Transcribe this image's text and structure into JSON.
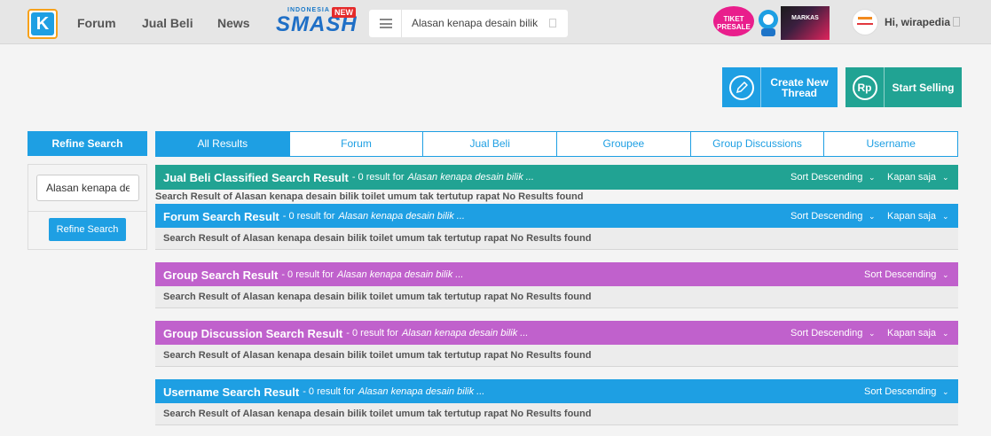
{
  "nav": {
    "logo": "K",
    "links": [
      "Forum",
      "Jual Beli",
      "News"
    ],
    "smash": {
      "top": "INDONESIA",
      "main": "SMASH",
      "badge": "NEW"
    },
    "search_value": "Alasan kenapa desain bilik",
    "promo": {
      "ticket_line1": "TIKET",
      "ticket_line2": "PRESALE",
      "event": "MARKAS"
    },
    "user_greeting": "Hi, wirapedia"
  },
  "actions": {
    "create_line1": "Create New",
    "create_line2": "Thread",
    "sell_icon": "Rp",
    "sell_label": "Start Selling"
  },
  "refine": {
    "heading": "Refine Search",
    "input_value": "Alasan kenapa desain bilik",
    "button": "Refine Search"
  },
  "tabs": [
    "All Results",
    "Forum",
    "Jual Beli",
    "Groupee",
    "Group Discussions",
    "Username"
  ],
  "results": [
    {
      "title": "Jual Beli Classified Search Result",
      "count": "- 0 result for",
      "query": "Alasan kenapa desain bilik ...",
      "sort": "Sort Descending",
      "time": "Kapan saja",
      "body": "Search Result of Alasan kenapa desain bilik toilet umum tak tertutup rapat No Results found"
    },
    {
      "title": "Forum Search Result",
      "count": "- 0 result for",
      "query": "Alasan kenapa desain bilik ...",
      "sort": "Sort Descending",
      "time": "Kapan saja",
      "body": "Search Result of Alasan kenapa desain bilik toilet umum tak tertutup rapat No Results found"
    },
    {
      "title": "Group Search Result",
      "count": "- 0 result for",
      "query": "Alasan kenapa desain bilik ...",
      "sort": "Sort Descending",
      "body": "Search Result of Alasan kenapa desain bilik toilet umum tak tertutup rapat No Results found"
    },
    {
      "title": "Group Discussion Search Result",
      "count": "- 0 result for",
      "query": "Alasan kenapa desain bilik ...",
      "sort": "Sort Descending",
      "time": "Kapan saja",
      "body": "Search Result of Alasan kenapa desain bilik toilet umum tak tertutup rapat No Results found"
    },
    {
      "title": "Username Search Result",
      "count": "- 0 result for",
      "query": "Alasan kenapa desain bilik ...",
      "sort": "Sort Descending",
      "body": "Search Result of Alasan kenapa desain bilik toilet umum tak tertutup rapat No Results found"
    }
  ],
  "caret": "⌄",
  "colors": {
    "blue": "#1e9fe3",
    "teal": "#21a393",
    "purple": "#c061cc",
    "logo_border": "#f7a11a"
  }
}
